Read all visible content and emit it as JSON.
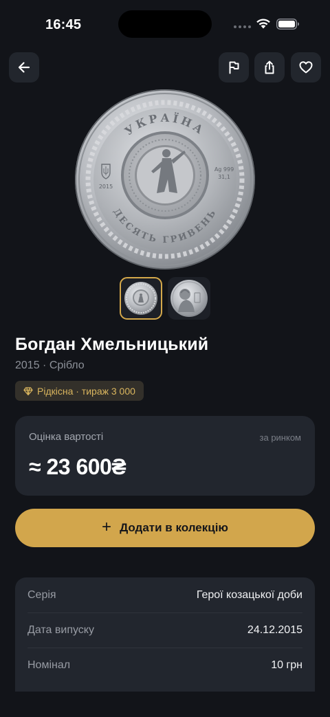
{
  "status": {
    "time": "16:45"
  },
  "icons": {
    "back": "arrow-left-icon",
    "flag": "flag-icon",
    "share": "share-icon",
    "favorite": "heart-icon",
    "badge": "diamond-icon",
    "add": "plus-icon"
  },
  "coin": {
    "title": "Богдан Хмельницький",
    "subtitle": "2015 · Срібло",
    "badge": "Рідкісна · тираж 3 000",
    "inscriptions": {
      "top": "УКРАЇНА",
      "bottom": "ДЕСЯТЬ ГРИВЕНЬ",
      "year": "2015",
      "metal": "Ag 999",
      "weight": "31,1"
    }
  },
  "valuation": {
    "label": "Оцінка вартості",
    "note": "за ринком",
    "amount": "≈ 23 600₴"
  },
  "actions": {
    "add_label": "Додати в колекцію"
  },
  "details": [
    {
      "label": "Серія",
      "value": "Герої козацької доби"
    },
    {
      "label": "Дата випуску",
      "value": "24.12.2015"
    },
    {
      "label": "Номінал",
      "value": "10 грн"
    }
  ],
  "colors": {
    "background": "#121419",
    "card": "#22262e",
    "accent": "#d2a64c",
    "badge_text": "#d9b55e"
  }
}
